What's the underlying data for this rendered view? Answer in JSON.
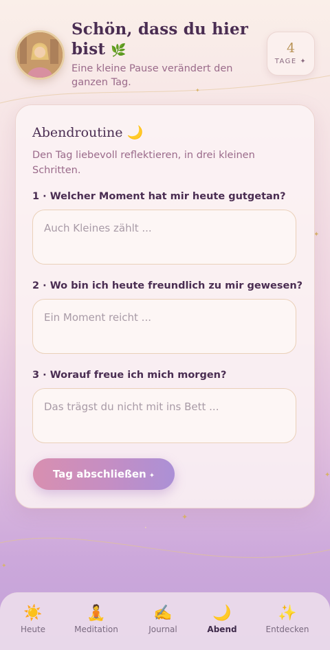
{
  "header": {
    "title": "Schön, dass du hier bist",
    "title_emoji": "🌿",
    "subtitle": "Eine kleine Pause verändert den ganzen Tag.",
    "avatar_icon": "user-photo",
    "streak": {
      "value": "4",
      "label": "TAGE ✦"
    }
  },
  "card": {
    "title": "Abendroutine",
    "title_emoji": "🌙",
    "description": "Den Tag liebevoll reflektieren, in drei kleinen Schritten.",
    "questions": [
      {
        "label": "1 · Welcher Moment hat mir heute gutgetan?",
        "placeholder": "Auch Kleines zählt ..."
      },
      {
        "label": "2 · Wo bin ich heute freundlich zu mir gewesen?",
        "placeholder": "Ein Moment reicht ..."
      },
      {
        "label": "3 · Worauf freue ich mich morgen?",
        "placeholder": "Das trägst du nicht mit ins Bett ..."
      }
    ],
    "button_label": "Tag abschließen",
    "button_icon": "✦"
  },
  "tabs": [
    {
      "label": "Heute",
      "icon": "☀️",
      "active": false
    },
    {
      "label": "Meditation",
      "icon": "🧘",
      "active": false
    },
    {
      "label": "Journal",
      "icon": "✍️",
      "active": false
    },
    {
      "label": "Abend",
      "icon": "🌙",
      "active": true
    },
    {
      "label": "Entdecken",
      "icon": "✨",
      "active": false
    }
  ],
  "colors": {
    "accent_gold": "#b89255",
    "text_primary": "#4a2d52",
    "text_secondary": "#9a6a8a",
    "button_gradient_start": "#d88fb0",
    "button_gradient_end": "#ab90d6"
  }
}
